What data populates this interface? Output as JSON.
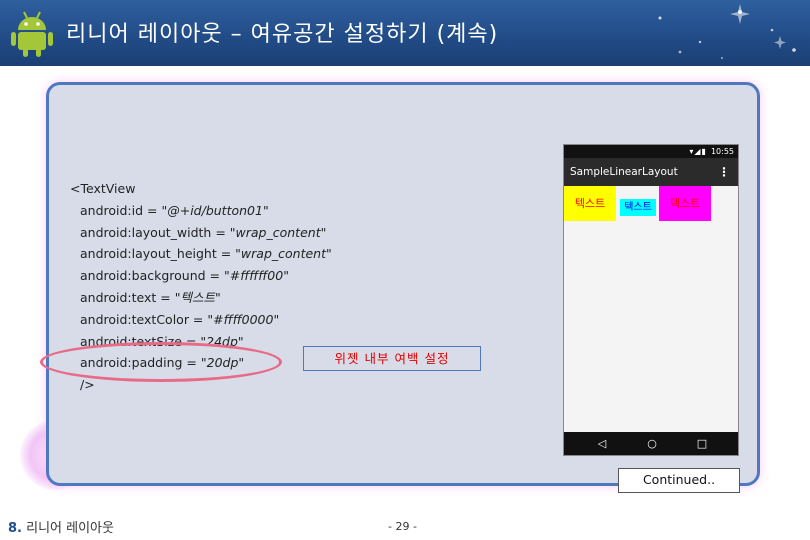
{
  "header": {
    "title": "리니어 레이아웃 – 여유공간 설정하기 (계속)",
    "icon": "android-robot-icon"
  },
  "code": {
    "lines": [
      {
        "prefix": "<TextView",
        "value": ""
      },
      {
        "prefix": "android:id = ",
        "value": "\"@+id/button01\""
      },
      {
        "prefix": "android:layout_width = ",
        "value": "\"wrap_content\""
      },
      {
        "prefix": "android:layout_height = ",
        "value": "\"wrap_content\""
      },
      {
        "prefix": "android:background = ",
        "value": "\"#ffffff00\""
      },
      {
        "prefix": "android:text = ",
        "value": "\"텍스트\""
      },
      {
        "prefix": "android:textColor = ",
        "value": "\"#ffff0000\""
      },
      {
        "prefix": "android:textSize = ",
        "value": "\"24dp\""
      },
      {
        "prefix": "android:padding = ",
        "value": "\"20dp\""
      },
      {
        "prefix": "/>",
        "value": ""
      }
    ]
  },
  "callout": {
    "text": "위젯 내부 여백 설정"
  },
  "phone": {
    "status_time": "10:55",
    "app_title": "SampleLinearLayout",
    "menu_icon": "overflow-menu-icon",
    "textviews": [
      {
        "text": "텍스트",
        "bg": "#ffff00",
        "color": "#ff0000"
      },
      {
        "text": "텍스트",
        "bg": "#00ffff",
        "color": "#0000ff"
      },
      {
        "text": "텍스트",
        "bg": "#ff00ff",
        "color": "#ff0000"
      }
    ],
    "nav": {
      "back": "◁",
      "home": "○",
      "recent": "□"
    }
  },
  "continued": "Continued..",
  "footer": {
    "chapter_num": "8.",
    "chapter_title": " 리니어 레이아웃",
    "page": "- 29 -"
  },
  "colors": {
    "header_bg": "#214b86",
    "panel_bg": "#d7dce8",
    "panel_border": "#4f79bf",
    "highlight": "#e86a86",
    "callout_text": "#e00000"
  }
}
